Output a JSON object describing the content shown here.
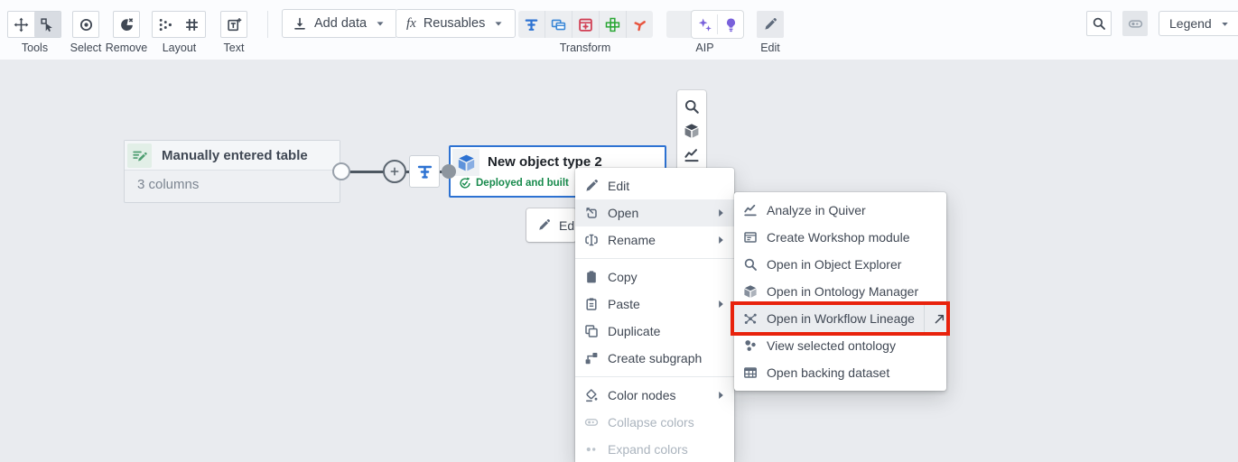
{
  "toolbar": {
    "groups": {
      "tools": {
        "label": "Tools",
        "buttons": [
          {
            "icon": "move-icon"
          },
          {
            "icon": "select-cursor-icon",
            "active": true
          }
        ]
      },
      "select": {
        "label": "Select",
        "icon": "target-icon"
      },
      "remove": {
        "label": "Remove",
        "icon": "remove-icon"
      },
      "layout": {
        "label": "Layout",
        "buttons": [
          {
            "icon": "layout-dots-icon"
          },
          {
            "icon": "layout-grid-icon"
          }
        ]
      },
      "text": {
        "label": "Text",
        "icon": "text-icon"
      },
      "add_data": {
        "label": "Add data",
        "icon": "download-icon"
      },
      "reusables": {
        "label": "Reusables",
        "fx_glyph": "fx"
      },
      "transform": {
        "label": "Transform",
        "buttons": [
          {
            "icon": "pipeline-transform-icon",
            "color": "#2d72d2"
          },
          {
            "icon": "layered-tables-icon",
            "color": "#3a87d6"
          },
          {
            "icon": "table-add-icon",
            "color": "#d13f54"
          },
          {
            "icon": "cross-table-icon",
            "color": "#29a634"
          },
          {
            "icon": "branch-icon",
            "color": "#e8553f"
          }
        ]
      },
      "aip": {
        "label": "AIP",
        "buttons": [
          {
            "icon": "aip-logo-icon"
          },
          {
            "icon": "sparkles-icon",
            "color": "#7961db"
          },
          {
            "icon": "lightbulb-icon",
            "color": "#7961db"
          }
        ]
      },
      "edit": {
        "label": "Edit",
        "icon": "pencil-icon"
      },
      "search": {
        "icon": "search-icon"
      },
      "colors_toggle": {
        "icon": "collapsed-pill-icon"
      },
      "legend": {
        "label": "Legend"
      }
    }
  },
  "canvas": {
    "table_node": {
      "title": "Manually entered table",
      "subtitle": "3 columns",
      "icon": "manual-table-icon"
    },
    "object_node": {
      "title": "New object type 2",
      "status": "Deployed and built",
      "icon": "cube-icon",
      "status_icon": "sync-check-icon",
      "border_color": "#2d72d2",
      "status_color": "#178a4c"
    },
    "edit_button": {
      "label": "Ed",
      "icon": "pencil-icon"
    },
    "side_toolbar": {
      "icons": [
        "search-icon",
        "cube-icon",
        "chart-line-icon"
      ]
    }
  },
  "context_menu": {
    "items": [
      {
        "label": "Edit",
        "icon": "pencil-icon"
      },
      {
        "label": "Open",
        "icon": "open-icon",
        "has_submenu": true,
        "hovered": true
      },
      {
        "label": "Rename",
        "icon": "rename-icon",
        "has_submenu": true
      },
      {
        "label": "Copy",
        "icon": "clipboard-icon"
      },
      {
        "label": "Paste",
        "icon": "paste-icon",
        "has_submenu": true
      },
      {
        "label": "Duplicate",
        "icon": "duplicate-icon"
      },
      {
        "label": "Create subgraph",
        "icon": "subgraph-icon"
      },
      {
        "label": "Color nodes",
        "icon": "paint-bucket-icon",
        "has_submenu": true
      },
      {
        "label": "Collapse colors",
        "icon": "collapsed-pill-icon",
        "disabled": true
      },
      {
        "label": "Expand colors",
        "icon": "two-dots-icon",
        "disabled": true
      }
    ]
  },
  "submenu": {
    "items": [
      {
        "label": "Analyze in Quiver",
        "icon": "chart-line-icon"
      },
      {
        "label": "Create Workshop module",
        "icon": "workshop-window-icon"
      },
      {
        "label": "Open in Object Explorer",
        "icon": "search-icon"
      },
      {
        "label": "Open in Ontology Manager",
        "icon": "cube-icon"
      },
      {
        "label": "Open in Workflow Lineage",
        "icon": "lineage-network-icon",
        "highlighted": true,
        "external_icon": "external-arrow-icon"
      },
      {
        "label": "View selected ontology",
        "icon": "ontology-cluster-icon"
      },
      {
        "label": "Open backing dataset",
        "icon": "dataset-table-icon"
      }
    ],
    "annotation_color": "#e8220c"
  },
  "colors": {
    "accent_blue": "#2d72d2",
    "status_green": "#178a4c",
    "annotation_red": "#e8220c",
    "aip_purple": "#7961db",
    "canvas_bg": "#e9ebef"
  }
}
